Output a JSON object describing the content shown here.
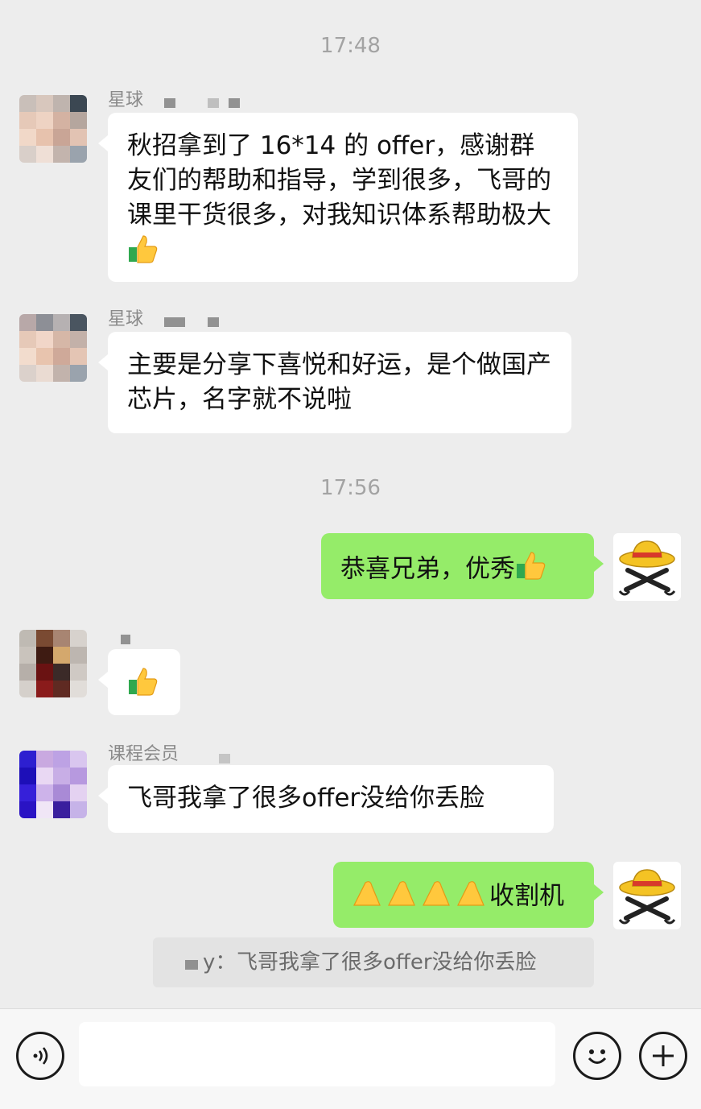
{
  "timestamps": [
    "17:48",
    "17:56"
  ],
  "messages": [
    {
      "sender": "星球",
      "text": "秋招拿到了 16*14 的 offer，感谢群友们的帮助和指导，学到很多，飞哥的课里干货很多，对我知识体系帮助极大",
      "emoji": "thumbs-up"
    },
    {
      "sender": "星球",
      "text": "主要是分享下喜悦和好运，是个做国产芯片，名字就不说啦"
    },
    {
      "sender": "self",
      "text": "恭喜兄弟，优秀",
      "emoji": "thumbs-up"
    },
    {
      "sender": "",
      "text": "",
      "emoji": "thumbs-up"
    },
    {
      "sender": "课程会员",
      "text": "飞哥我拿了很多offer没给你丢脸"
    },
    {
      "sender": "self",
      "text": "收割机",
      "emoji": "pray-hands-x4"
    }
  ],
  "quote": {
    "separator": "y：",
    "text": "飞哥我拿了很多offer没给你丢脸"
  },
  "toolbar": {
    "voice_icon": "voice-icon",
    "emoji_icon": "emoji-icon",
    "plus_icon": "plus-icon"
  },
  "colors": {
    "background": "#ededed",
    "bubble_self": "#95ec69",
    "bubble_other": "#ffffff",
    "timestamp": "#a3a3a3"
  }
}
